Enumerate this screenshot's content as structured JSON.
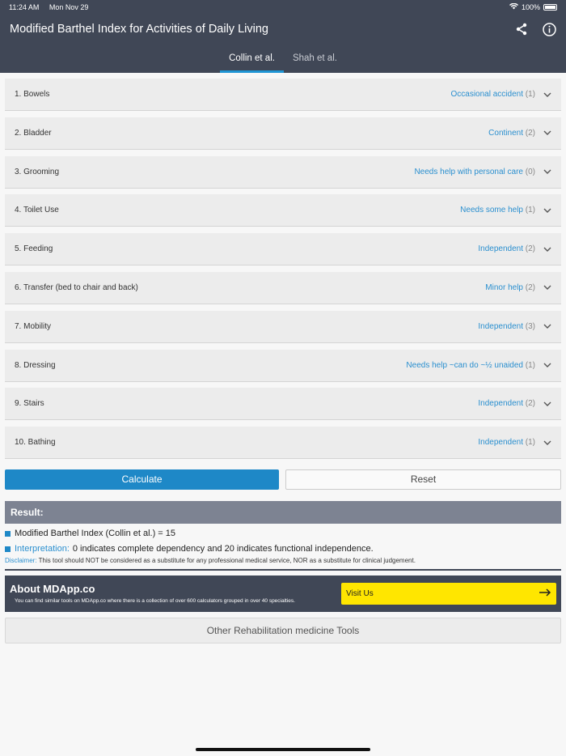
{
  "status": {
    "time": "11:24 AM",
    "date": "Mon Nov 29",
    "battery": "100%"
  },
  "header": {
    "title": "Modified Barthel Index for Activities of Daily Living",
    "share_icon": "share-icon",
    "info_icon": "info-icon"
  },
  "tabs": [
    {
      "label": "Collin et al.",
      "active": true
    },
    {
      "label": "Shah et al.",
      "active": false
    }
  ],
  "items": [
    {
      "label": "1. Bowels",
      "value": "Occasional accident",
      "score": "(1)"
    },
    {
      "label": "2. Bladder",
      "value": "Continent",
      "score": "(2)"
    },
    {
      "label": "3. Grooming",
      "value": "Needs help with personal care",
      "score": "(0)"
    },
    {
      "label": "4. Toilet Use",
      "value": "Needs some help",
      "score": "(1)"
    },
    {
      "label": "5. Feeding",
      "value": "Independent",
      "score": "(2)"
    },
    {
      "label": "6. Transfer (bed to chair and back)",
      "value": "Minor help",
      "score": "(2)"
    },
    {
      "label": "7. Mobility",
      "value": "Independent",
      "score": "(3)"
    },
    {
      "label": "8. Dressing",
      "value": "Needs help ~can do ~½ unaided",
      "score": "(1)"
    },
    {
      "label": "9. Stairs",
      "value": "Independent",
      "score": "(2)"
    },
    {
      "label": "10. Bathing",
      "value": "Independent",
      "score": "(1)"
    }
  ],
  "actions": {
    "calculate": "Calculate",
    "reset": "Reset"
  },
  "result": {
    "heading": "Result:",
    "line1": "Modified Barthel Index (Collin et al.) = 15",
    "interp_label": "Interpretation:",
    "interp_text": "0 indicates complete dependency and 20 indicates functional independence.",
    "disclaimer_label": "Disclaimer:",
    "disclaimer_text": "This tool should NOT be considered as a substitute for any professional medical service, NOR as a substitute for clinical judgement."
  },
  "about": {
    "title": "About MDApp.co",
    "desc": "You can find similar tools on MDApp.co where there is a collection of over 600 calculators grouped in over 40 specialties.",
    "visit": "Visit Us"
  },
  "other_tools": "Other Rehabilitation medicine Tools",
  "colors": {
    "header": "#404756",
    "accent": "#1e88c7",
    "visit": "#ffe600"
  }
}
